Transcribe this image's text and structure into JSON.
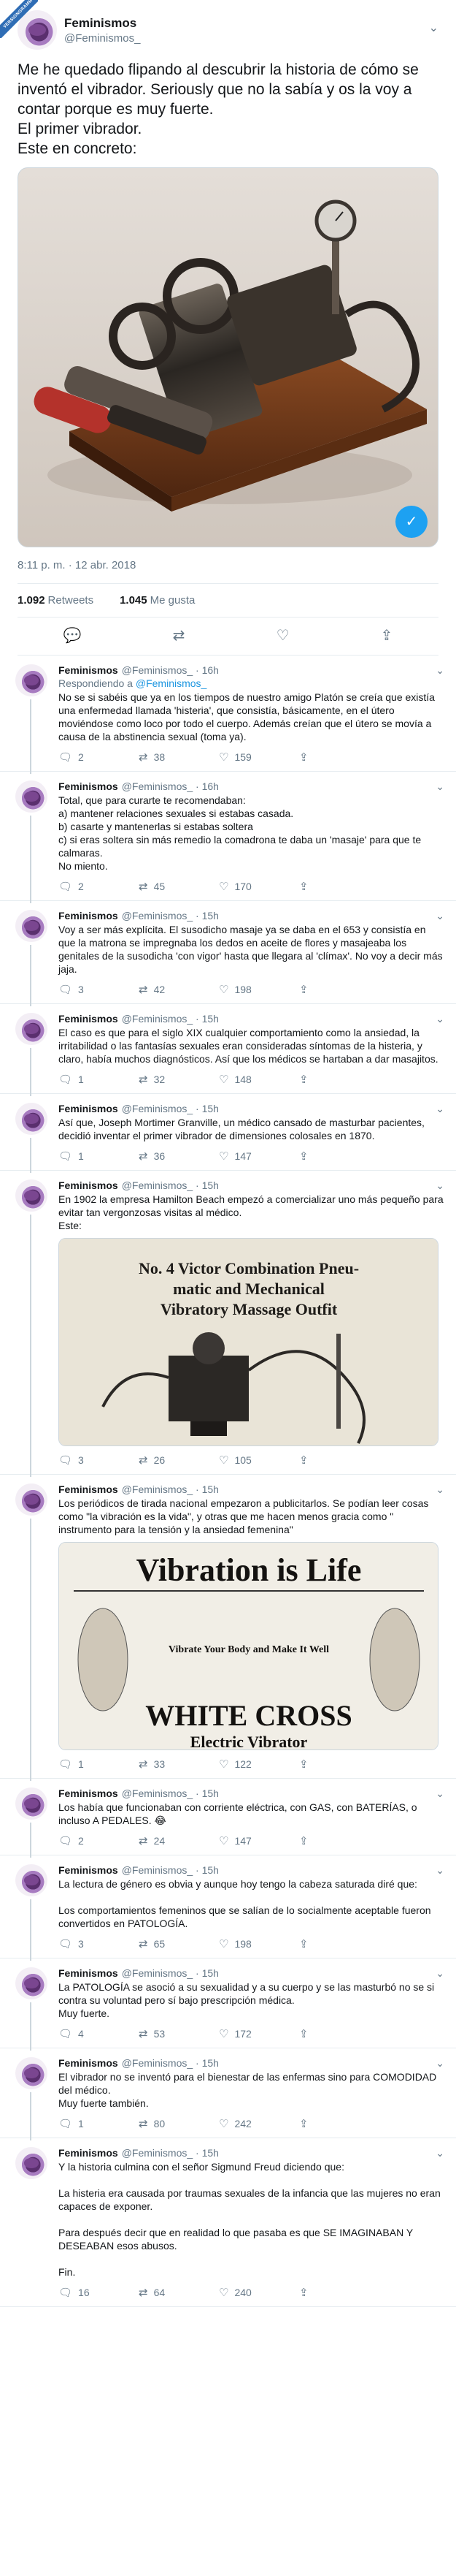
{
  "corner_badge": "VERSIONGRAMM",
  "main": {
    "name": "Feminismos",
    "handle": "@Feminismos_",
    "text": "Me he quedado flipando al descubrir la historia de cómo se inventó el vibrador. Seriously que no la sabía y os la voy a contar porque es muy fuerte.\nEl primer vibrador.\nEste en concreto:",
    "timestamp": "8:11 p. m. · 12 abr. 2018",
    "retweets_count": "1.092",
    "retweets_label": "Retweets",
    "likes_count": "1.045",
    "likes_label": "Me gusta",
    "gif_label": "✓"
  },
  "replies": [
    {
      "name": "Feminismos",
      "handle": "@Feminismos_ · 16h",
      "replying": "Respondiendo a",
      "mention": "@Feminismos_",
      "text": "No se si sabéis que ya en los tiempos de nuestro amigo Platón se creía que existía una enfermedad llamada 'histeria', que consistía, básicamente, en el útero moviéndose como loco por todo el cuerpo. Además creían que el útero se movía a causa de la abstinencia sexual (toma ya).",
      "replies": "2",
      "retweets": "38",
      "likes": "159"
    },
    {
      "name": "Feminismos",
      "handle": "@Feminismos_ · 16h",
      "text": "Total, que para curarte te recomendaban:\na) mantener relaciones sexuales si estabas casada.\nb) casarte y mantenerlas si estabas soltera\nc) si eras soltera sin más remedio la comadrona te daba un 'masaje' para que te calmaras.\nNo miento.",
      "replies": "2",
      "retweets": "45",
      "likes": "170"
    },
    {
      "name": "Feminismos",
      "handle": "@Feminismos_ · 15h",
      "text": "Voy a ser más explícita. El susodicho masaje ya se daba en el 653 y consistía en que la matrona se impregnaba los dedos en aceite de flores y masajeaba los genitales de la susodicha 'con vigor' hasta que llegara al 'clímax'. No voy a decir más jaja.",
      "replies": "3",
      "retweets": "42",
      "likes": "198"
    },
    {
      "name": "Feminismos",
      "handle": "@Feminismos_ · 15h",
      "text": "El caso es que para el siglo XIX cualquier comportamiento como la ansiedad, la irritabilidad o las fantasías sexuales eran consideradas síntomas de la histeria, y claro, había muchos diagnósticos. Así que los médicos se hartaban a dar masajitos.",
      "replies": "1",
      "retweets": "32",
      "likes": "148"
    },
    {
      "name": "Feminismos",
      "handle": "@Feminismos_ · 15h",
      "text": "Así que, Joseph Mortimer Granville, un médico cansado de masturbar pacientes, decidió inventar el primer vibrador de dimensiones colosales en 1870.",
      "replies": "1",
      "retweets": "36",
      "likes": "147"
    },
    {
      "name": "Feminismos",
      "handle": "@Feminismos_ · 15h",
      "text": "En 1902 la empresa Hamilton Beach empezó a comercializar uno más pequeño para evitar tan vergonzosas visitas al médico.\nEste:",
      "media": {
        "kind": "victor",
        "line1": "No. 4 Victor Combination Pneu-",
        "line2": "matic and Mechanical",
        "line3": "Vibratory Massage Outfit"
      },
      "replies": "3",
      "retweets": "26",
      "likes": "105"
    },
    {
      "name": "Feminismos",
      "handle": "@Feminismos_ · 15h",
      "text": "Los periódicos de tirada nacional empezaron a publicitarlos. Se podían leer cosas como \"la vibración es la vida\", y otras que me hacen menos gracia como \" instrumento para la tensión y la ansiedad femenina\"",
      "media": {
        "kind": "adv",
        "headline": "Vibration is Life",
        "sub": "Vibrate Your Body and Make It Well",
        "brand": "WHITE CROSS",
        "brand2": "Electric Vibrator"
      },
      "replies": "1",
      "retweets": "33",
      "likes": "122"
    },
    {
      "name": "Feminismos",
      "handle": "@Feminismos_ · 15h",
      "text": "Los había que funcionaban con corriente eléctrica, con GAS, con BATERÍAS, o incluso A PEDALES. 😂",
      "replies": "2",
      "retweets": "24",
      "likes": "147"
    },
    {
      "name": "Feminismos",
      "handle": "@Feminismos_ · 15h",
      "text": "La lectura de género es obvia y aunque hoy tengo la cabeza saturada diré que:\n\nLos comportamientos femeninos que se salían de lo socialmente aceptable fueron convertidos en PATOLOGÍA.",
      "replies": "3",
      "retweets": "65",
      "likes": "198"
    },
    {
      "name": "Feminismos",
      "handle": "@Feminismos_ · 15h",
      "text": "La PATOLOGÍA se asoció a su sexualidad y a su cuerpo y se las masturbó no se si contra su voluntad pero sí bajo prescripción médica.\nMuy fuerte.",
      "replies": "4",
      "retweets": "53",
      "likes": "172"
    },
    {
      "name": "Feminismos",
      "handle": "@Feminismos_ · 15h",
      "text": "El vibrador no se inventó para el bienestar de las enfermas sino para COMODIDAD del médico.\nMuy fuerte también.",
      "replies": "1",
      "retweets": "80",
      "likes": "242"
    },
    {
      "name": "Feminismos",
      "handle": "@Feminismos_ · 15h",
      "text": "Y la historia culmina con el señor Sigmund Freud diciendo que:\n\nLa histeria era causada por traumas sexuales de la infancia que las mujeres no eran capaces de exponer.\n\nPara después decir que en realidad lo que pasaba es que SE IMAGINABAN Y DESEABAN esos abusos.\n\nFin.",
      "replies": "16",
      "retweets": "64",
      "likes": "240"
    }
  ],
  "colors": {
    "accent": "#1da1f2",
    "muted": "#657786",
    "divider": "#e6ecf0"
  },
  "icons": {
    "reply": "reply-icon",
    "retweet": "retweet-icon",
    "like": "heart-icon",
    "share": "share-icon"
  }
}
